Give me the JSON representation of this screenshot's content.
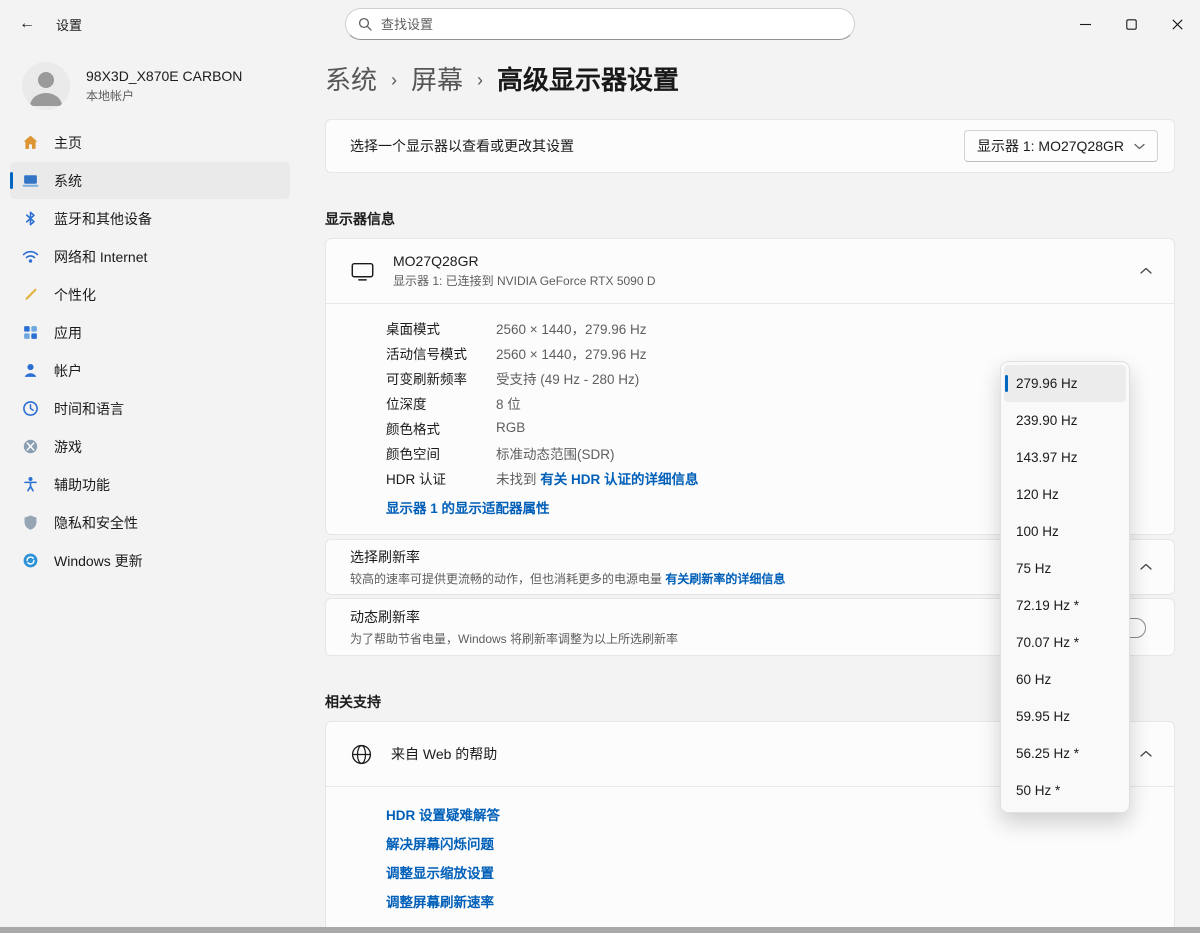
{
  "titlebar": {
    "app_title": "设置",
    "search_placeholder": "查找设置"
  },
  "sidebar": {
    "user": {
      "name": "98X3D_X870E CARBON",
      "type": "本地帐户"
    },
    "items": [
      {
        "label": "主页"
      },
      {
        "label": "系统"
      },
      {
        "label": "蓝牙和其他设备"
      },
      {
        "label": "网络和 Internet"
      },
      {
        "label": "个性化"
      },
      {
        "label": "应用"
      },
      {
        "label": "帐户"
      },
      {
        "label": "时间和语言"
      },
      {
        "label": "游戏"
      },
      {
        "label": "辅助功能"
      },
      {
        "label": "隐私和安全性"
      },
      {
        "label": "Windows 更新"
      }
    ]
  },
  "breadcrumb": {
    "seg1": "系统",
    "separator": "›",
    "seg2": "屏幕",
    "seg3": "高级显示器设置"
  },
  "display_select": {
    "label": "选择一个显示器以查看或更改其设置",
    "dropdown_value": "显示器 1: MO27Q28GR"
  },
  "display_info": {
    "section_title": "显示器信息",
    "monitor_name": "MO27Q28GR",
    "monitor_subtitle": "显示器 1: 已连接到 NVIDIA GeForce RTX 5090 D",
    "rows": [
      {
        "label": "桌面模式",
        "value": "2560 × 1440，279.96 Hz"
      },
      {
        "label": "活动信号模式",
        "value": "2560 × 1440，279.96 Hz"
      },
      {
        "label": "可变刷新频率",
        "value": "受支持 (49 Hz - 280 Hz)"
      },
      {
        "label": "位深度",
        "value": "8 位"
      },
      {
        "label": "颜色格式",
        "value": "RGB"
      },
      {
        "label": "颜色空间",
        "value": "标准动态范围(SDR)"
      }
    ],
    "hdr_row": {
      "label": "HDR 认证",
      "value_prefix": "未找到 ",
      "link": "有关 HDR 认证的详细信息"
    },
    "adapter_link": "显示器 1 的显示适配器属性"
  },
  "refresh_rate": {
    "title": "选择刷新率",
    "subtitle": "较高的速率可提供更流畅的动作，但也消耗更多的电源电量 ",
    "link": "有关刷新率的详细信息",
    "selected_option": "279.96 Hz",
    "flyout_options": [
      "279.96 Hz",
      "239.90 Hz",
      "143.97 Hz",
      "120 Hz",
      "100 Hz",
      "75 Hz",
      "72.19 Hz *",
      "70.07 Hz *",
      "60 Hz",
      "59.95 Hz",
      "56.25 Hz *",
      "50 Hz *"
    ]
  },
  "dynamic_refresh": {
    "title": "动态刷新率",
    "subtitle": "为了帮助节省电量，Windows 将刷新率调整为以上所选刷新率"
  },
  "related": {
    "section_title": "相关支持",
    "card_title": "来自 Web 的帮助",
    "links": [
      "HDR 设置疑难解答",
      "解决屏幕闪烁问题",
      "调整显示缩放设置",
      "调整屏幕刷新速率"
    ]
  }
}
